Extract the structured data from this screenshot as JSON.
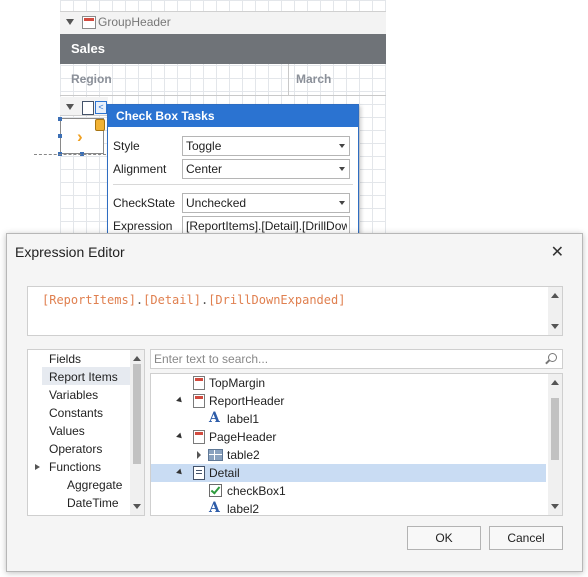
{
  "designer": {
    "group_header_label": "GroupHeader",
    "sales_title": "Sales",
    "col_region": "Region",
    "col_march": "March"
  },
  "checkbox_tasks": {
    "title": "Check Box Tasks",
    "style_label": "Style",
    "style_value": "Toggle",
    "alignment_label": "Alignment",
    "alignment_value": "Center",
    "checkstate_label": "CheckState",
    "checkstate_value": "Unchecked",
    "expression_label": "Expression",
    "expression_value": "[ReportItems].[Detail].[DrillDown"
  },
  "expression_editor": {
    "title": "Expression Editor",
    "close_glyph": "✕",
    "expression_parts": [
      "[ReportItems]",
      ".",
      "[Detail]",
      ".",
      "[DrillDownExpanded]"
    ],
    "categories": [
      "Fields",
      "Report Items",
      "Variables",
      "Constants",
      "Values",
      "Operators",
      "Functions",
      "Aggregate",
      "DateTime"
    ],
    "selected_category": "Report Items",
    "search_placeholder": "Enter text to search...",
    "tree": [
      {
        "label": "TopMargin",
        "icon": "band-icon"
      },
      {
        "label": "ReportHeader",
        "icon": "band-icon",
        "expanded": true
      },
      {
        "label": "label1",
        "icon": "label-icon"
      },
      {
        "label": "PageHeader",
        "icon": "band-icon",
        "expanded": true
      },
      {
        "label": "table2",
        "icon": "table-icon",
        "collapsed": true
      },
      {
        "label": "Detail",
        "icon": "detail-band-icon",
        "expanded": true,
        "selected": true
      },
      {
        "label": "checkBox1",
        "icon": "checkbox-icon"
      },
      {
        "label": "label2",
        "icon": "label-icon"
      }
    ],
    "ok_label": "OK",
    "cancel_label": "Cancel"
  },
  "colors": {
    "tasks_title_bg": "#2b73d1",
    "selection_bg": "#c9dcf3",
    "expression_text": "#e08050",
    "sales_header_bg": "#6f7378"
  }
}
